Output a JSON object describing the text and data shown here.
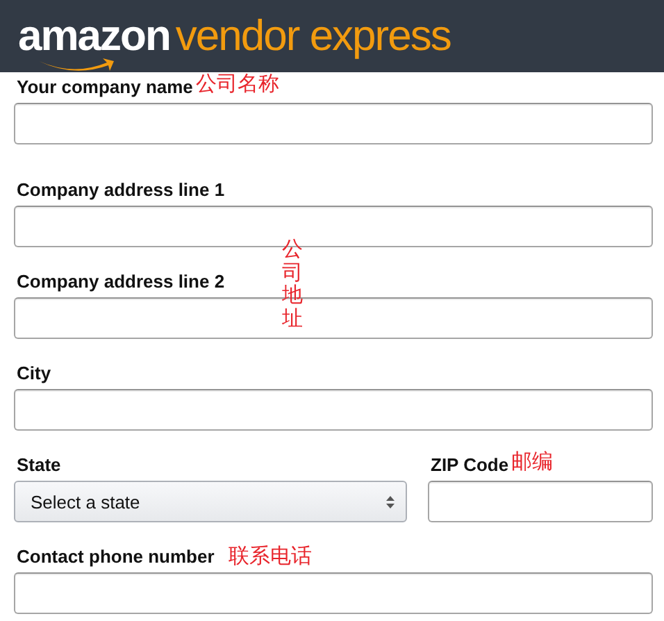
{
  "header": {
    "logo_brand": "amazon",
    "logo_product": "vendor express"
  },
  "rows": [
    {
      "fields": [
        {
          "label": "Your company name",
          "kind": "text",
          "note": "公司名称"
        }
      ]
    },
    {
      "fields": [
        {
          "label": "Company address line 1",
          "kind": "text"
        }
      ]
    },
    {
      "fields": [
        {
          "label": "Company address line 2",
          "kind": "text"
        }
      ]
    },
    {
      "fields": [
        {
          "label": "City",
          "kind": "text"
        }
      ]
    },
    {
      "fields": [
        {
          "label": "State",
          "kind": "select",
          "value": "Select a state"
        },
        {
          "label": "ZIP Code",
          "kind": "text",
          "note": "邮编"
        }
      ]
    },
    {
      "fields": [
        {
          "label": "Contact phone number",
          "kind": "text",
          "note": "联系电话"
        }
      ]
    }
  ],
  "side_note": "公司地址"
}
